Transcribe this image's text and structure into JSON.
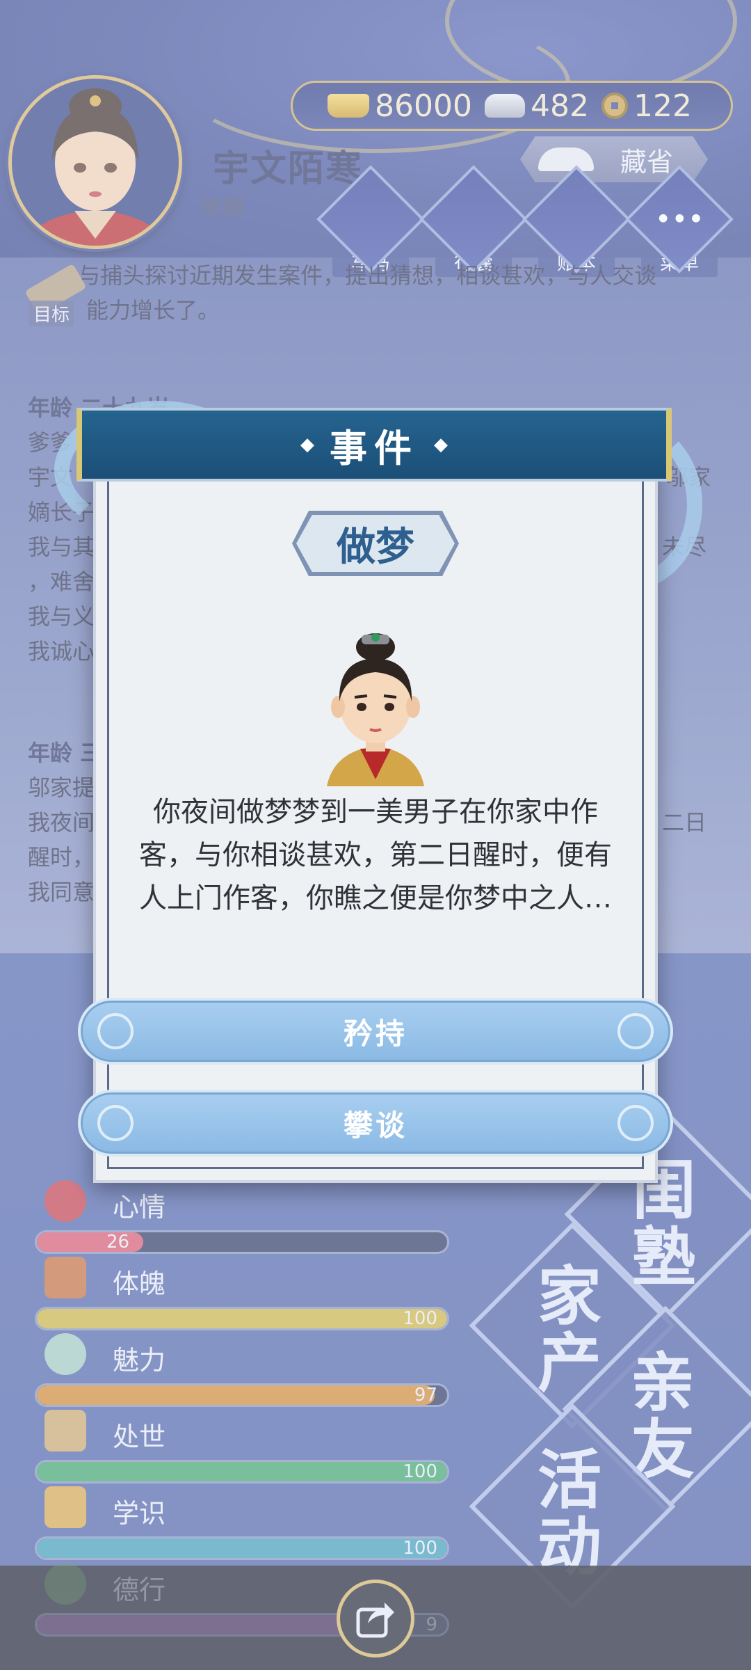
{
  "player": {
    "name": "宇文陌寒",
    "title": "徐娘"
  },
  "currency": {
    "gold": "86000",
    "silver": "482",
    "copper": "122"
  },
  "top_buttons": {
    "save": "藏省",
    "menu": [
      "车马",
      "行囊",
      "账本",
      "菜单"
    ],
    "target": "目标"
  },
  "log": {
    "line1": "… 与捕头探讨近期发生案件，提出猜想，相谈甚欢，与人交谈",
    "line2": "能力增长了。",
    "age1": "年龄 二十九岁",
    "entries1": [
      "爹爹",
      "宇文",
      "嫡长子",
      "我与其",
      "，难舍",
      "我与义",
      "我诚心"
    ],
    "entries1_right": [
      "邬家",
      "未尽"
    ],
    "age2": "年龄 三",
    "entries2": [
      "邬家提",
      "我夜间",
      "醒时，",
      "我同意"
    ],
    "entries2_right": "二日"
  },
  "dialog": {
    "header": "事件",
    "event_title": "做梦",
    "description": "你夜间做梦梦到一美男子在你家中作客，与你相谈甚欢，第二日醒时，便有人上门作客，你瞧之便是你梦中之人…",
    "choices": [
      "矜持",
      "攀谈"
    ]
  },
  "stats": [
    {
      "label": "心情",
      "value": "26",
      "fraction": 0.26,
      "color": "#d9546e"
    },
    {
      "label": "体魄",
      "value": "100",
      "fraction": 1.0,
      "color": "#c9b23e"
    },
    {
      "label": "魅力",
      "value": "97",
      "fraction": 0.97,
      "color": "#d0872e"
    },
    {
      "label": "处世",
      "value": "100",
      "fraction": 1.0,
      "color": "#3aa36a"
    },
    {
      "label": "学识",
      "value": "100",
      "fraction": 1.0,
      "color": "#3a9cb8"
    },
    {
      "label": "德行",
      "value": "9",
      "fraction": 0.9,
      "color": "#8a3fa6"
    }
  ],
  "side_menu": {
    "school": "闺塾",
    "estate": "家产",
    "relatives": "亲友",
    "activity": "活动"
  },
  "icons": {
    "share": "share-icon"
  }
}
